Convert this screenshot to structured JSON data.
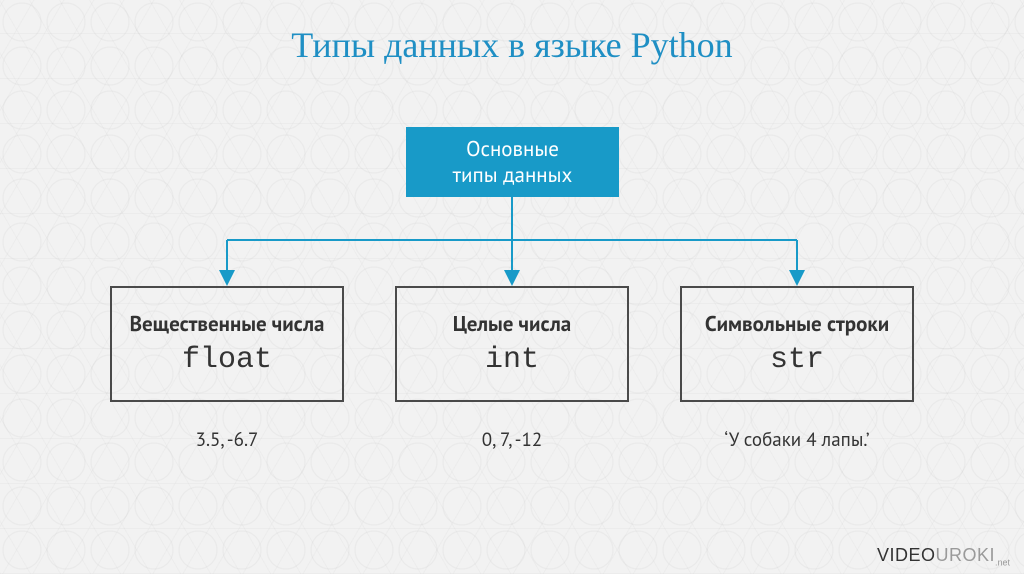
{
  "title": "Типы данных в языке Python",
  "root": {
    "line1": "Основные",
    "line2": "типы данных"
  },
  "leaves": {
    "float": {
      "label": "Вещественные числа",
      "type": "float",
      "examples": "3.5, -6.7"
    },
    "int": {
      "label": "Целые числа",
      "type": "int",
      "examples": "0, 7, -12"
    },
    "str": {
      "label": "Символьные строки",
      "type": "str",
      "examples": "‘У собаки 4 лапы.’"
    }
  },
  "watermark": {
    "brand1": "VIDEO",
    "brand2": "UROKI",
    "suffix": ".net"
  },
  "chart_data": {
    "type": "tree",
    "title": "Типы данных в языке Python",
    "root": "Основные типы данных",
    "children": [
      {
        "name": "Вещественные числа",
        "keyword": "float",
        "examples": "3.5, -6.7"
      },
      {
        "name": "Целые числа",
        "keyword": "int",
        "examples": "0, 7, -12"
      },
      {
        "name": "Символьные строки",
        "keyword": "str",
        "examples": "‘У собаки 4 лапы.’"
      }
    ]
  }
}
